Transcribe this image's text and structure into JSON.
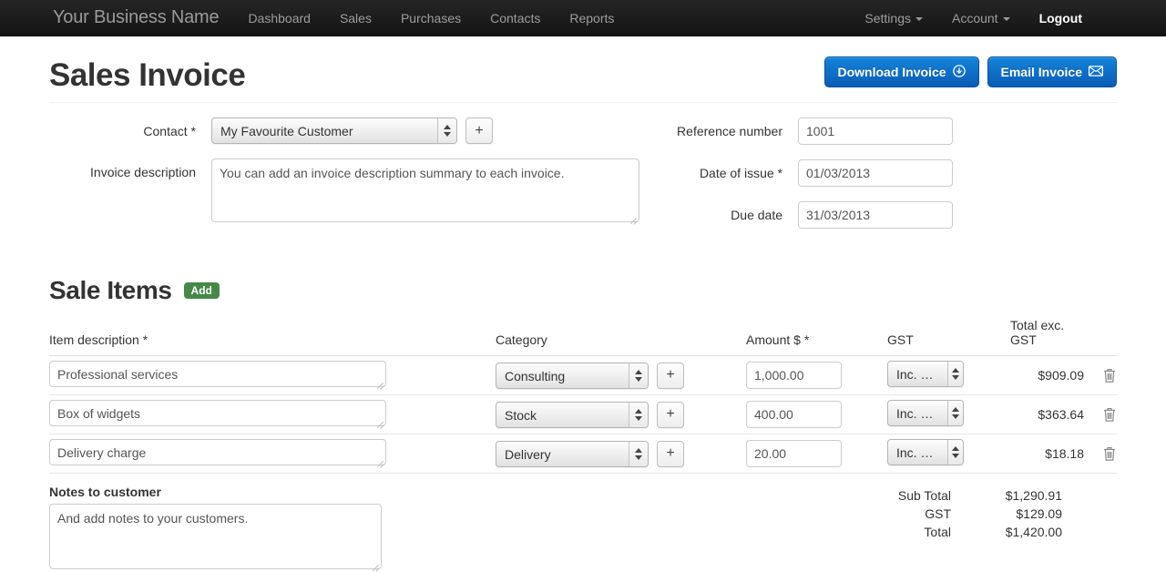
{
  "navbar": {
    "brand": "Your Business Name",
    "links": [
      {
        "label": "Dashboard"
      },
      {
        "label": "Sales"
      },
      {
        "label": "Purchases"
      },
      {
        "label": "Contacts"
      },
      {
        "label": "Reports"
      }
    ],
    "right": [
      {
        "label": "Settings",
        "caret": true
      },
      {
        "label": "Account",
        "caret": true
      },
      {
        "label": "Logout",
        "caret": false
      }
    ]
  },
  "header": {
    "title": "Sales Invoice",
    "download_label": "Download Invoice",
    "download_icon": "download-circle-icon",
    "email_label": "Email Invoice",
    "email_icon": "envelope-icon"
  },
  "form": {
    "contact_label": "Contact *",
    "contact_value": "My Favourite Customer",
    "contact_add_label": "+",
    "description_label": "Invoice description",
    "description_value": "You can add an invoice description summary to each invoice.",
    "reference_label": "Reference number",
    "reference_value": "1001",
    "date_issue_label": "Date of issue *",
    "date_issue_value": "01/03/2013",
    "due_date_label": "Due date",
    "due_date_value": "31/03/2013"
  },
  "sale_items": {
    "title": "Sale Items",
    "add_badge": "Add",
    "columns": {
      "description": "Item description *",
      "category": "Category",
      "amount": "Amount $ *",
      "gst": "GST",
      "total": "Total exc. GST"
    },
    "rows": [
      {
        "description": "Professional services",
        "category": "Consulting",
        "add_label": "+",
        "amount": "1,000.00",
        "gst": "Inc. GST",
        "total": "$909.09",
        "delete_icon": "trash-icon"
      },
      {
        "description": "Box of widgets",
        "category": "Stock",
        "add_label": "+",
        "amount": "400.00",
        "gst": "Inc. GST",
        "total": "$363.64",
        "delete_icon": "trash-icon"
      },
      {
        "description": "Delivery charge",
        "category": "Delivery",
        "add_label": "+",
        "amount": "20.00",
        "gst": "Inc. GST",
        "total": "$18.18",
        "delete_icon": "trash-icon"
      }
    ]
  },
  "notes": {
    "label": "Notes to customer",
    "value": "And add notes to your customers."
  },
  "totals": [
    {
      "label": "Sub Total",
      "value": "$1,290.91"
    },
    {
      "label": "GST",
      "value": "$129.09"
    },
    {
      "label": "Total",
      "value": "$1,420.00"
    }
  ],
  "colors": {
    "navbar_dark": "#141414",
    "primary_blue": "#0a5cb6",
    "badge_green": "#468847"
  }
}
